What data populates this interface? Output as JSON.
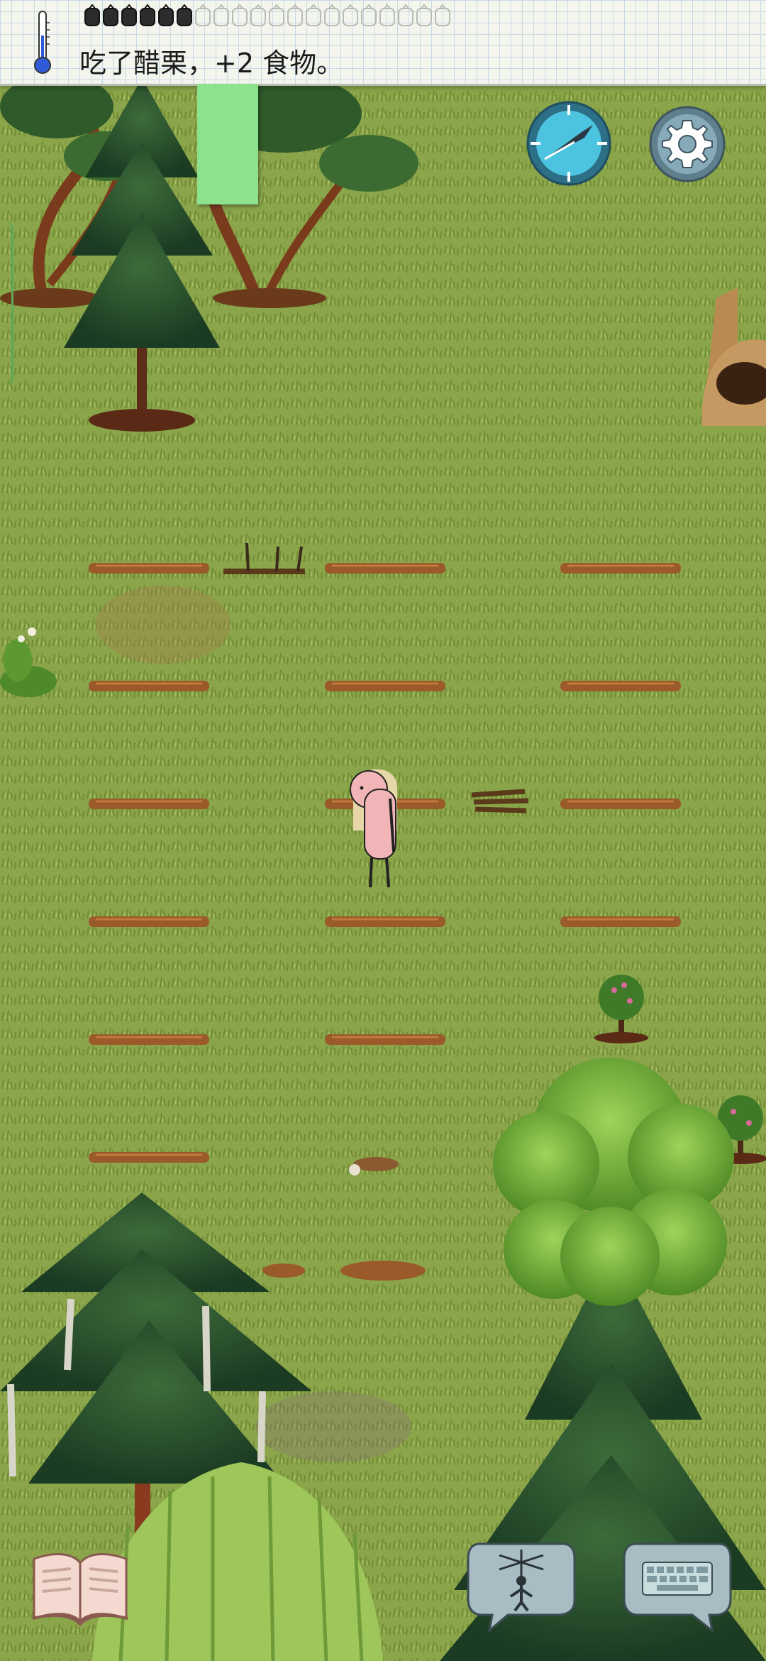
{
  "status_message": "吃了醋栗，+2 食物。",
  "food_pips": {
    "filled": 6,
    "total": 20
  },
  "colors": {
    "grass": "#8aa54a",
    "compass": "#3bb6d1",
    "settings": "#6d8a97",
    "soil_row": "#9a5a2a",
    "food_bar_tab": "#8de28e"
  },
  "icons": {
    "thermometer": "thermometer-icon",
    "compass": "compass-icon",
    "settings": "gear-icon",
    "book": "book-icon",
    "puppet": "puppet-icon",
    "keyboard": "keyboard-icon"
  }
}
